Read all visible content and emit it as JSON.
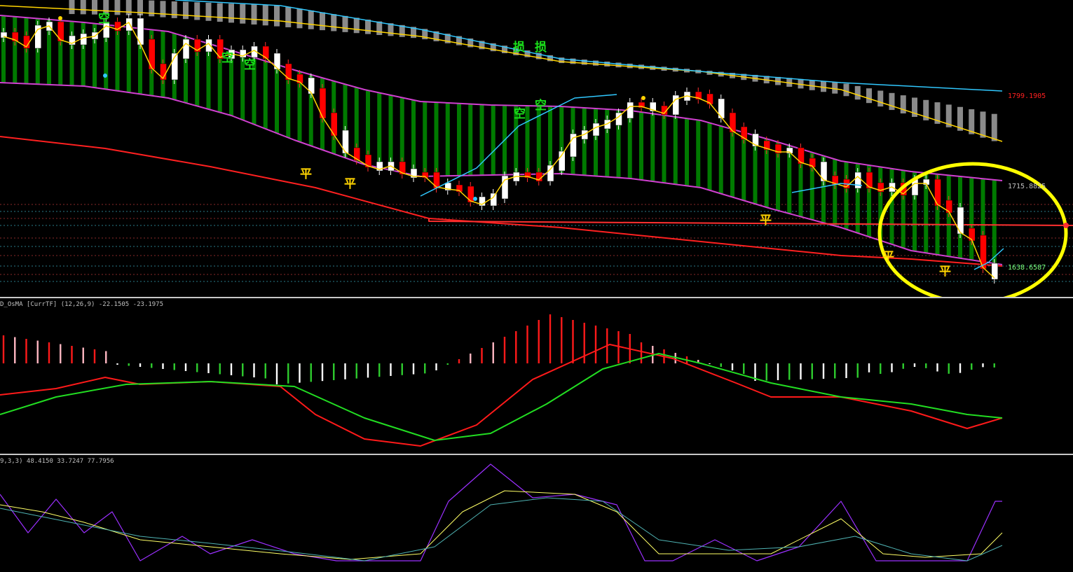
{
  "panes": {
    "macd_title": "D_OsMA [CurrTF] (12,26,9) -22.1505 -23.1975",
    "stoch_title": "9,3,3) 48.4150 33.7247 77.7956"
  },
  "price_labels": [
    {
      "text": "1799.1905",
      "color": "#ff2020"
    },
    {
      "text": "1715.8825",
      "color": "#c0c0c0"
    },
    {
      "text": "1638.6587",
      "color": "#7cff7c"
    }
  ],
  "signals": {
    "sell_char": "空",
    "close_char": "平",
    "stop_char": "损",
    "sell_color": "#1adf1a",
    "close_color": "#ffd400",
    "stop_color": "#1adf1a"
  },
  "colors": {
    "bull_candle": "#ffffff",
    "bear_candle": "#ff0000",
    "channel_fill": "#007a00",
    "cloud_fill": "#8a8a8a",
    "envelope": "#d040d0",
    "long_ma": "#ff2020",
    "fast_ma": "#ffd400",
    "cyan_ma": "#30c8ff",
    "highlight_circle": "#ffff00",
    "macd_signal": "#22dd22",
    "macd_line": "#ff1a1a",
    "stoch_k": "#9b30ff",
    "stoch_d": "#ffff66",
    "stoch_slow": "#4fb3b3"
  }
}
